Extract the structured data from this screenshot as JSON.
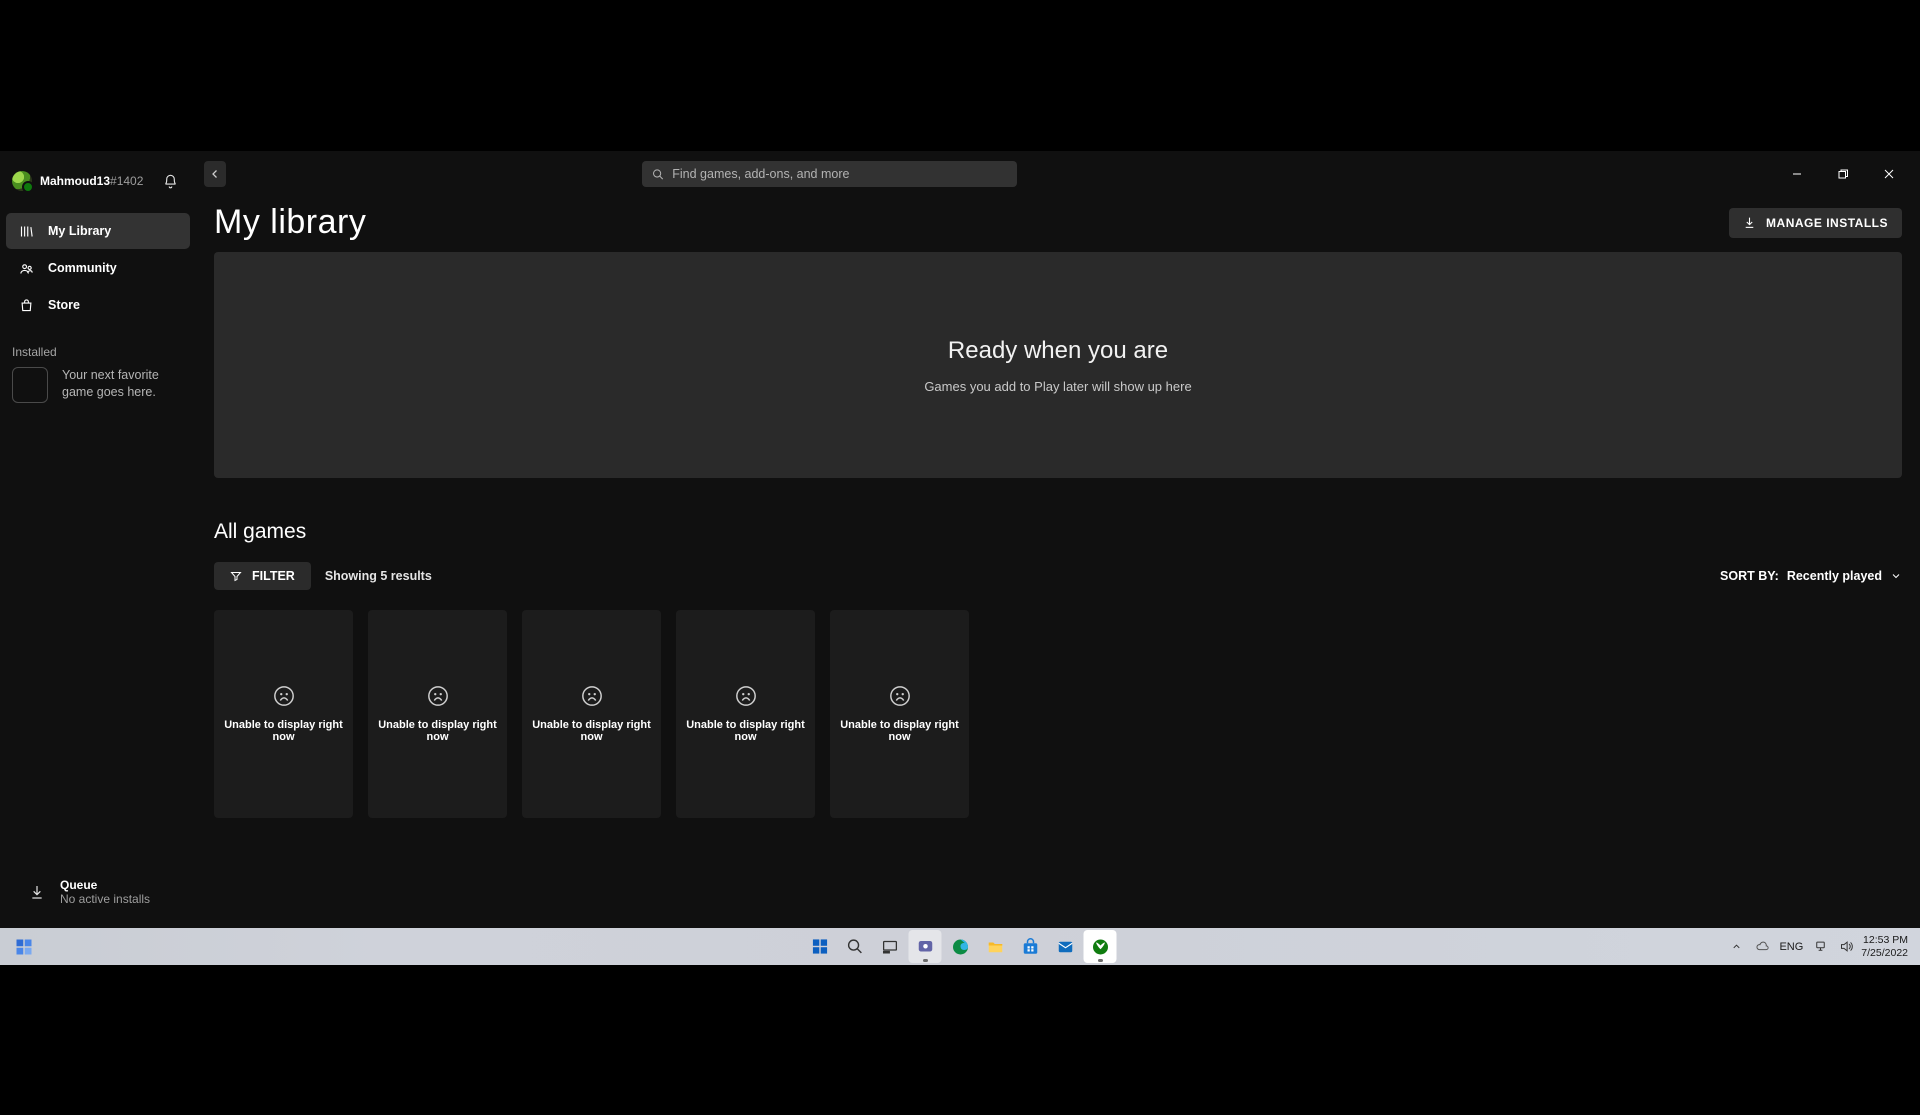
{
  "header": {
    "username": "Mahmoud13",
    "usertag": "#1402",
    "search_placeholder": "Find games, add-ons, and more"
  },
  "sidebar": {
    "items": [
      {
        "label": "My Library"
      },
      {
        "label": "Community"
      },
      {
        "label": "Store"
      }
    ],
    "installed_label": "Installed",
    "installed_placeholder": "Your next favorite game goes here."
  },
  "queue": {
    "title": "Queue",
    "subtitle": "No active installs"
  },
  "main": {
    "title": "My library",
    "manage_button": "MANAGE INSTALLS",
    "hero_title": "Ready when you are",
    "hero_subtitle": "Games you add to Play later will show up here",
    "allgames_title": "All games",
    "filter_label": "FILTER",
    "results_text": "Showing 5 results",
    "sort_prefix": "SORT BY:",
    "sort_value": "Recently played",
    "cards": [
      {
        "label": "Unable to display right now"
      },
      {
        "label": "Unable to display right now"
      },
      {
        "label": "Unable to display right now"
      },
      {
        "label": "Unable to display right now"
      },
      {
        "label": "Unable to display right now"
      }
    ]
  },
  "taskbar": {
    "lang": "ENG",
    "time": "12:53 PM",
    "date": "7/25/2022"
  }
}
